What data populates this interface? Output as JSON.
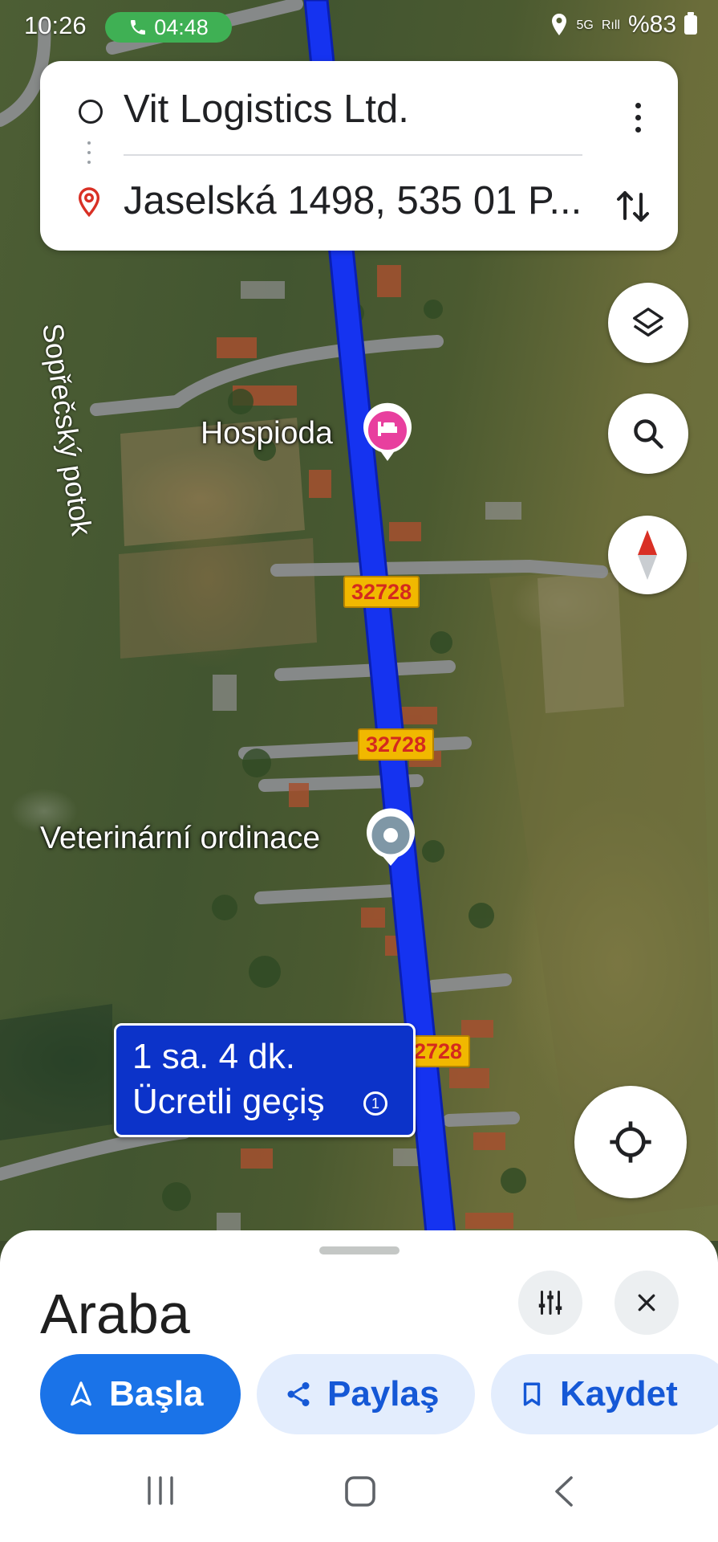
{
  "status_bar": {
    "time": "10:26",
    "call_timer": "04:48",
    "network": "5G",
    "signal_label": "R",
    "battery": "%83"
  },
  "route": {
    "origin": "Vit Logistics Ltd.",
    "destination": "Jaselská 1498, 535 01 P..."
  },
  "map": {
    "poi_hospoda": "Hospioda",
    "poi_vet": "Veterinární ordinace",
    "stream_name": "Sopřečský potok",
    "road_number_1": "32728",
    "road_number_2": "32728",
    "road_number_3": "2728",
    "route_color": "#1533f0"
  },
  "eta": {
    "duration": "1 sa. 4 dk.",
    "toll": "Ücretli geçiş"
  },
  "bottom_sheet": {
    "mode": "Araba",
    "start_label": "Başla",
    "share_label": "Paylaş",
    "save_label": "Kaydet"
  },
  "icons": [
    "phone-icon",
    "location-status-icon",
    "circle-origin-icon",
    "pin-icon",
    "more-vert-icon",
    "swap-icon",
    "layers-icon",
    "search-icon",
    "compass-icon",
    "my-location-icon",
    "hotel-icon",
    "place-icon",
    "toll-icon",
    "options-icon",
    "close-icon",
    "navigation-icon",
    "share-icon",
    "bookmark-icon",
    "recents-icon",
    "home-icon",
    "back-icon"
  ]
}
